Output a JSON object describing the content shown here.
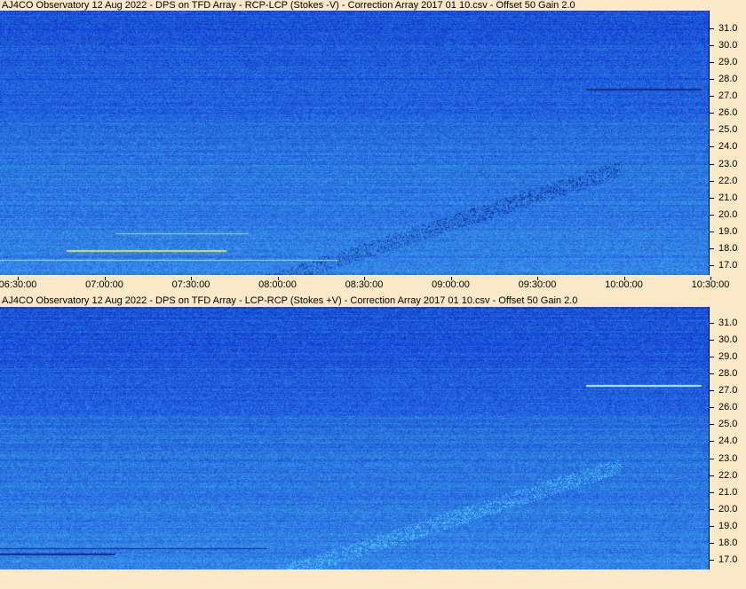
{
  "panels": [
    {
      "title": "AJ4CO Observatory 12 Aug 2022  -  DPS on TFD Array  -  RCP-LCP (Stokes -V)  -  Correction Array 2017 01 10.csv  -  Offset 50  Gain 2.0",
      "y_labels": [
        "31.0",
        "30.0",
        "29.0",
        "28.0",
        "27.0",
        "26.0",
        "25.0",
        "24.0",
        "23.0",
        "22.0",
        "21.0",
        "20.0",
        "19.0",
        "18.0",
        "17.0"
      ],
      "x_labels": [
        "06:30:00",
        "07:00:00",
        "07:30:00",
        "08:00:00",
        "08:30:00",
        "09:00:00",
        "09:30:00",
        "10:00:00",
        "10:30:00"
      ]
    },
    {
      "title": "AJ4CO Observatory 12 Aug 2022  -  DPS on TFD Array  -  LCP-RCP (Stokes +V)  -  Correction Array 2017 01 10.csv  -  Offset 50  Gain 2.0",
      "y_labels": [
        "31.0",
        "30.0",
        "29.0",
        "28.0",
        "27.0",
        "26.0",
        "25.0",
        "24.0",
        "23.0",
        "22.0",
        "21.0",
        "20.0",
        "19.0",
        "18.0",
        "17.0"
      ]
    }
  ],
  "colors": {
    "background": "#fde8c8",
    "spectrogram_base": "#2a6ee0",
    "burst_dark": "#0a2a8a",
    "burst_light": "#7fe6ff",
    "burst_yellow": "#d8e060"
  }
}
